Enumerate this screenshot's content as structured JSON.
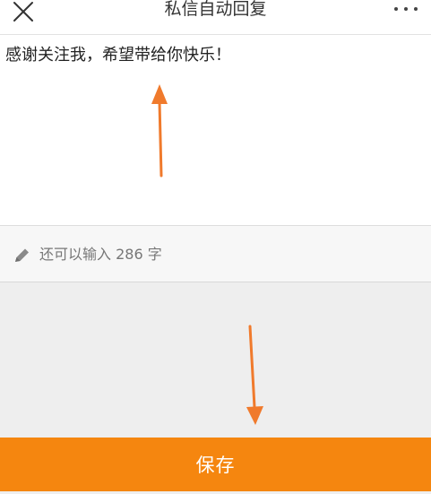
{
  "header": {
    "title": "私信自动回复",
    "close_icon": "close-icon",
    "more_icon": "more-dots-icon"
  },
  "editor": {
    "text": "感谢关注我，希望带给你快乐！"
  },
  "counter": {
    "prefix": "还可以输入",
    "count": "286",
    "suffix": "字",
    "icon": "pencil-icon"
  },
  "footer": {
    "save_label": "保存"
  },
  "annotations": {
    "arrow_up_icon": "arrow-up-icon",
    "arrow_down_icon": "arrow-down-icon"
  },
  "colors": {
    "accent": "#f5860f",
    "annotation_arrow": "#f07a2c",
    "background": "#eeeeee"
  }
}
